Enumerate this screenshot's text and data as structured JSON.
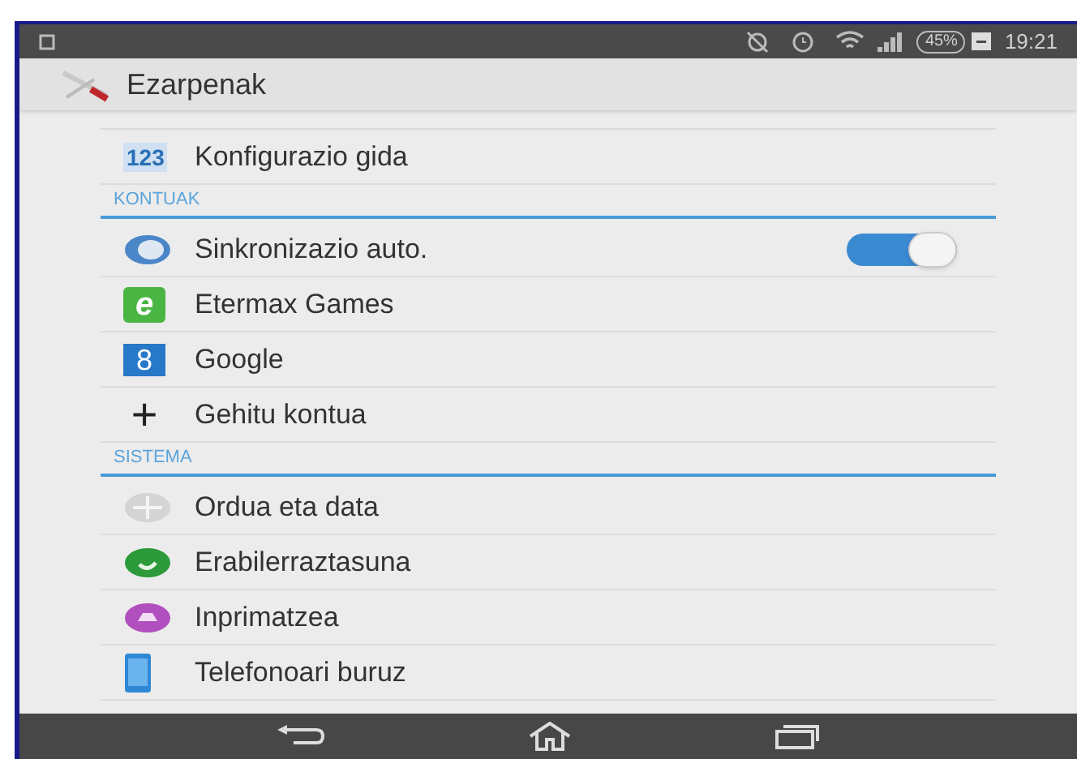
{
  "status_bar": {
    "battery": "45%",
    "time": "19:21"
  },
  "action_bar": {
    "title": "Ezarpenak"
  },
  "sections": [
    {
      "kind": "item",
      "label": "Konfigurazio gida",
      "icon_text": "123"
    },
    {
      "kind": "header",
      "label": "KONTUAK"
    },
    {
      "kind": "item",
      "label": "Sinkronizazio auto.",
      "toggle": {
        "on": true
      }
    },
    {
      "kind": "item",
      "label": "Etermax Games",
      "icon_text": "e"
    },
    {
      "kind": "item",
      "label": "Google",
      "icon_text": "8"
    },
    {
      "kind": "item",
      "label": "Gehitu kontua",
      "icon_text": "+"
    },
    {
      "kind": "header",
      "label": "SISTEMA"
    },
    {
      "kind": "item",
      "label": "Ordua eta data"
    },
    {
      "kind": "item",
      "label": "Erabilerraztasuna"
    },
    {
      "kind": "item",
      "label": "Inprimatzea"
    },
    {
      "kind": "item",
      "label": "Telefonoari buruz"
    }
  ]
}
